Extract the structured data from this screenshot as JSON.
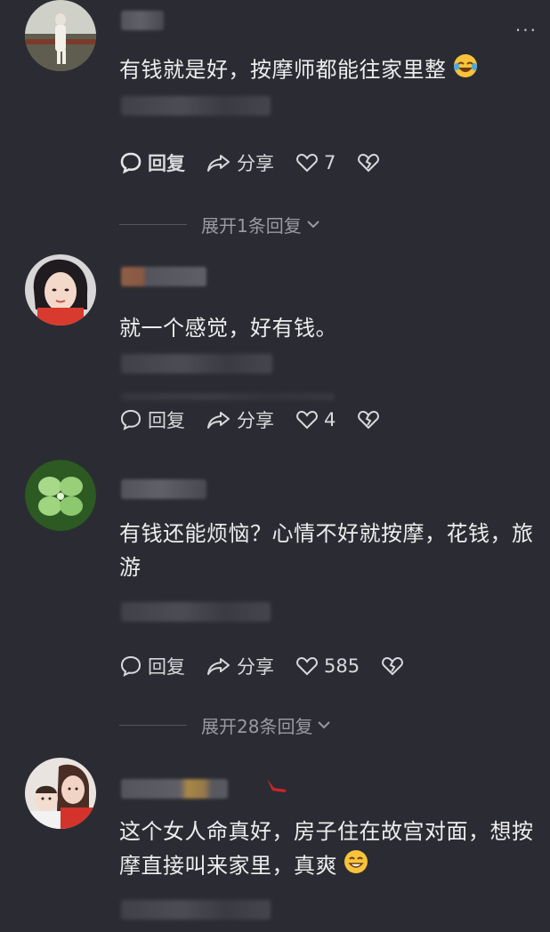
{
  "more_icon": "more-dots-icon",
  "comments": [
    {
      "text": "有钱就是好，按摩师都能往家里整",
      "emoji": "rofl-emoji-icon",
      "reply_label": "回复",
      "share_label": "分享",
      "likes": "7",
      "expand": "展开1条回复"
    },
    {
      "text": "就一个感觉，好有钱。",
      "reply_label": "回复",
      "share_label": "分享",
      "likes": "4"
    },
    {
      "text": "有钱还能烦恼？心情不好就按摩，花钱，旅游",
      "reply_label": "回复",
      "share_label": "分享",
      "likes": "585",
      "expand": "展开28条回复"
    },
    {
      "text": "这个女人命真好，房子住在故宫对面，想按摩直接叫来家里，真爽",
      "emoji": "grin-emoji-icon"
    }
  ],
  "colors": {
    "background": "#2b2c33",
    "text": "#ededee",
    "muted": "#9a9aa0"
  }
}
